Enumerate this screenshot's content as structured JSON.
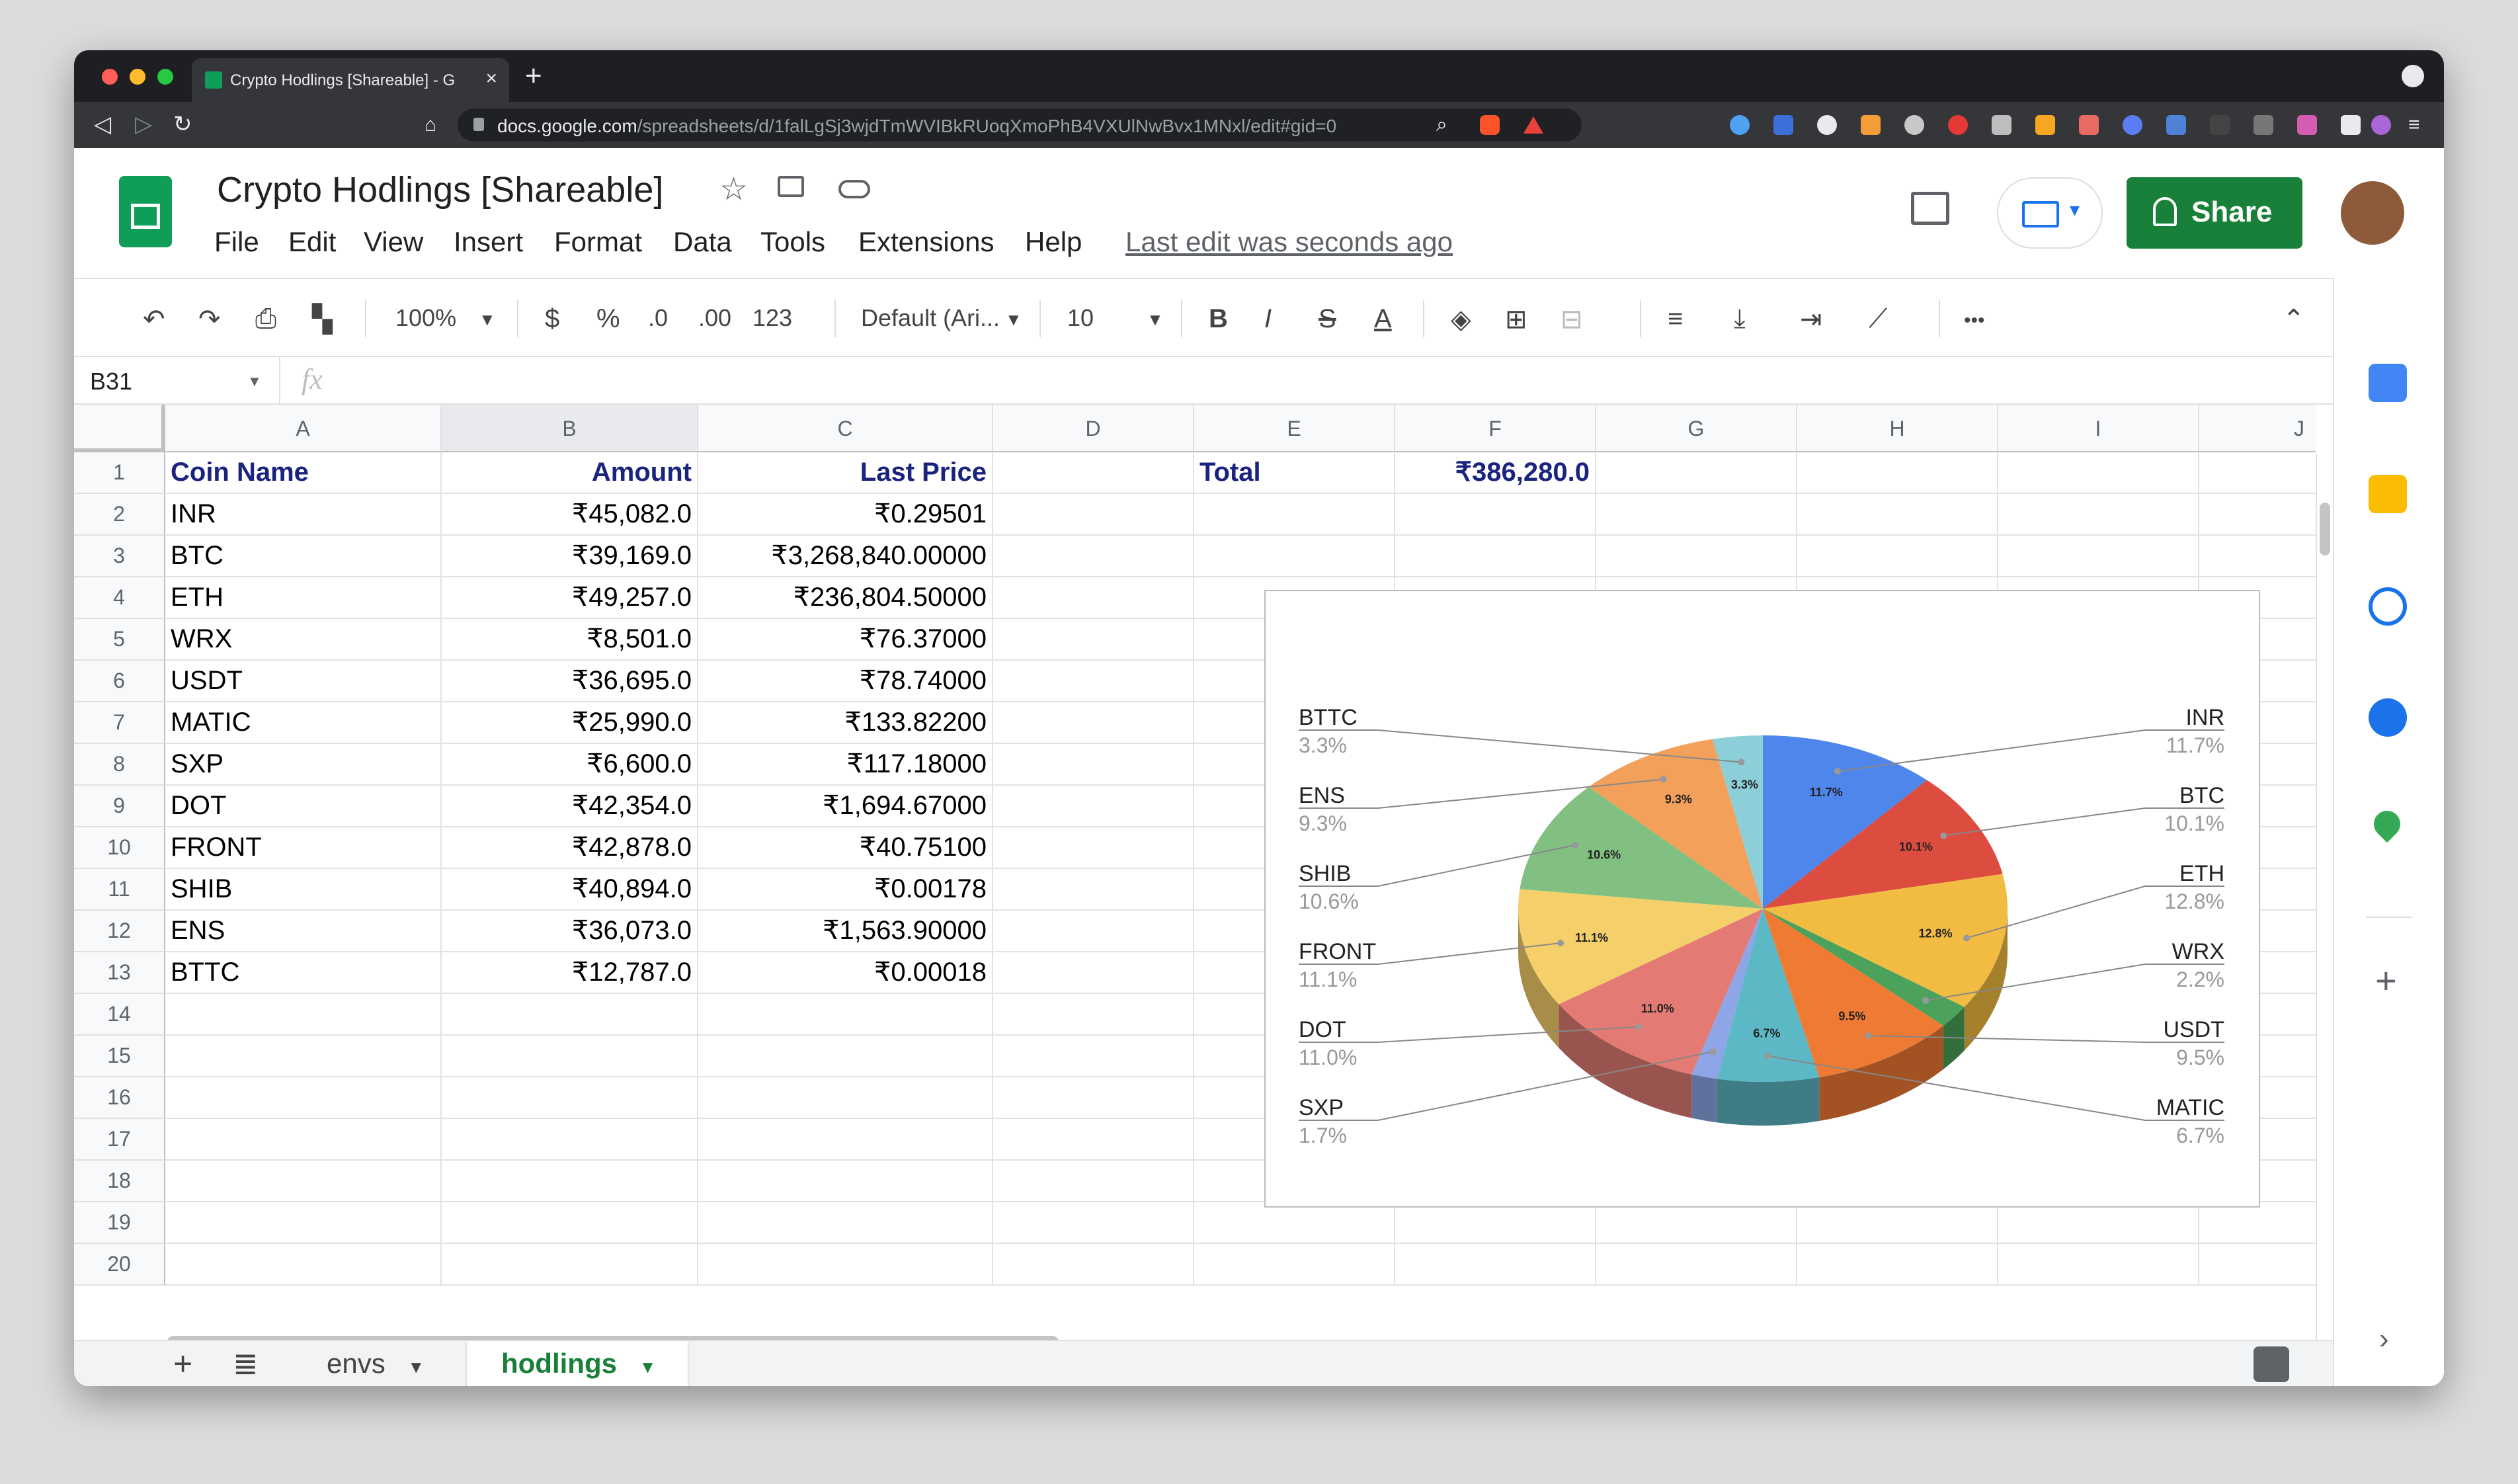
{
  "browser": {
    "tab_title": "Crypto Hodlings [Shareable] - G",
    "url_host": "docs.google.com",
    "url_rest": "/spreadsheets/d/1falLgSj3wjdTmWVIBkRUoqXmoPhB4VXUlNwBvx1MNxl/edit#gid=0"
  },
  "doc": {
    "title": "Crypto Hodlings [Shareable]",
    "menus": [
      "File",
      "Edit",
      "View",
      "Insert",
      "Format",
      "Data",
      "Tools",
      "Extensions",
      "Help"
    ],
    "last_edit": "Last edit was seconds ago",
    "share_label": "Share"
  },
  "toolbar": {
    "zoom": "100%",
    "currency": "$",
    "percent": "%",
    "dec_minus": ".0",
    "dec_plus": ".00",
    "format_more": "123",
    "font": "Default (Ari...",
    "font_size": "10",
    "bold": "B",
    "italic": "I",
    "strike": "S",
    "textcolor": "A",
    "more": "•••"
  },
  "formula_bar": {
    "name_box": "B31",
    "fx": "fx"
  },
  "grid": {
    "columns": [
      "A",
      "B",
      "C",
      "D",
      "E",
      "F",
      "G",
      "H",
      "I",
      "J"
    ],
    "rows": [
      "1",
      "2",
      "3",
      "4",
      "5",
      "6",
      "7",
      "8",
      "9",
      "10",
      "11",
      "12",
      "13",
      "14",
      "15",
      "16",
      "17",
      "18",
      "19",
      "20"
    ],
    "header": {
      "coin": "Coin Name",
      "amount": "Amount",
      "price": "Last Price",
      "total_label": "Total",
      "total_value": "₹386,280.0"
    },
    "data": [
      [
        "INR",
        "₹45,082.0",
        "₹0.29501"
      ],
      [
        "BTC",
        "₹39,169.0",
        "₹3,268,840.00000"
      ],
      [
        "ETH",
        "₹49,257.0",
        "₹236,804.50000"
      ],
      [
        "WRX",
        "₹8,501.0",
        "₹76.37000"
      ],
      [
        "USDT",
        "₹36,695.0",
        "₹78.74000"
      ],
      [
        "MATIC",
        "₹25,990.0",
        "₹133.82200"
      ],
      [
        "SXP",
        "₹6,600.0",
        "₹117.18000"
      ],
      [
        "DOT",
        "₹42,354.0",
        "₹1,694.67000"
      ],
      [
        "FRONT",
        "₹42,878.0",
        "₹40.75100"
      ],
      [
        "SHIB",
        "₹40,894.0",
        "₹0.00178"
      ],
      [
        "ENS",
        "₹36,073.0",
        "₹1,563.90000"
      ],
      [
        "BTTC",
        "₹12,787.0",
        "₹0.00018"
      ]
    ]
  },
  "chart_data": {
    "type": "pie",
    "three_d": true,
    "categories": [
      "INR",
      "BTC",
      "ETH",
      "WRX",
      "USDT",
      "MATIC",
      "SXP",
      "DOT",
      "FRONT",
      "SHIB",
      "ENS",
      "BTTC"
    ],
    "values": [
      11.7,
      10.1,
      12.8,
      2.2,
      9.5,
      6.7,
      1.7,
      11.0,
      11.1,
      10.6,
      9.3,
      3.3
    ],
    "labels": [
      "11.7%",
      "10.1%",
      "12.8%",
      "2.2%",
      "9.5%",
      "6.7%",
      "1.7%",
      "11.0%",
      "11.1%",
      "10.6%",
      "9.3%",
      "3.3%"
    ],
    "colors": [
      "#4e86ec",
      "#dc4c3f",
      "#f2bc42",
      "#4ca25a",
      "#ef7a33",
      "#5bb8c4",
      "#8ea6e8",
      "#e37b74",
      "#f5d06a",
      "#81c081",
      "#f3a05a",
      "#8ccfd8"
    ],
    "legend": "labeled-lines"
  },
  "sheets": {
    "tabs": [
      "envs",
      "hodlings"
    ],
    "active": "hodlings"
  }
}
